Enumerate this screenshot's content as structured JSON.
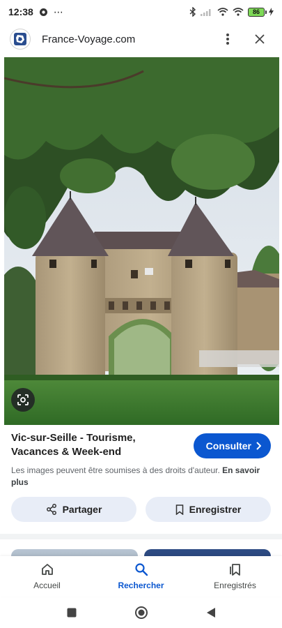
{
  "status_bar": {
    "time": "12:38",
    "extra": "⋯",
    "battery": "86"
  },
  "header": {
    "site_name": "France-Voyage.com"
  },
  "result": {
    "title": "Vic-sur-Seille - Tourisme, Vacances & Week-end",
    "consult_label": "Consulter",
    "copyright_text": "Les images peuvent être soumises à des droits d'auteur.",
    "learn_more": "En savoir plus"
  },
  "actions": {
    "share_label": "Partager",
    "save_label": "Enregistrer"
  },
  "bottom_nav": {
    "items": [
      {
        "label": "Accueil",
        "icon": "home-icon"
      },
      {
        "label": "Rechercher",
        "icon": "search-icon"
      },
      {
        "label": "Enregistrés",
        "icon": "saved-icon"
      }
    ],
    "active": "Rechercher"
  },
  "colors": {
    "accent": "#0b57d0",
    "chip_background": "#e8edf7"
  }
}
